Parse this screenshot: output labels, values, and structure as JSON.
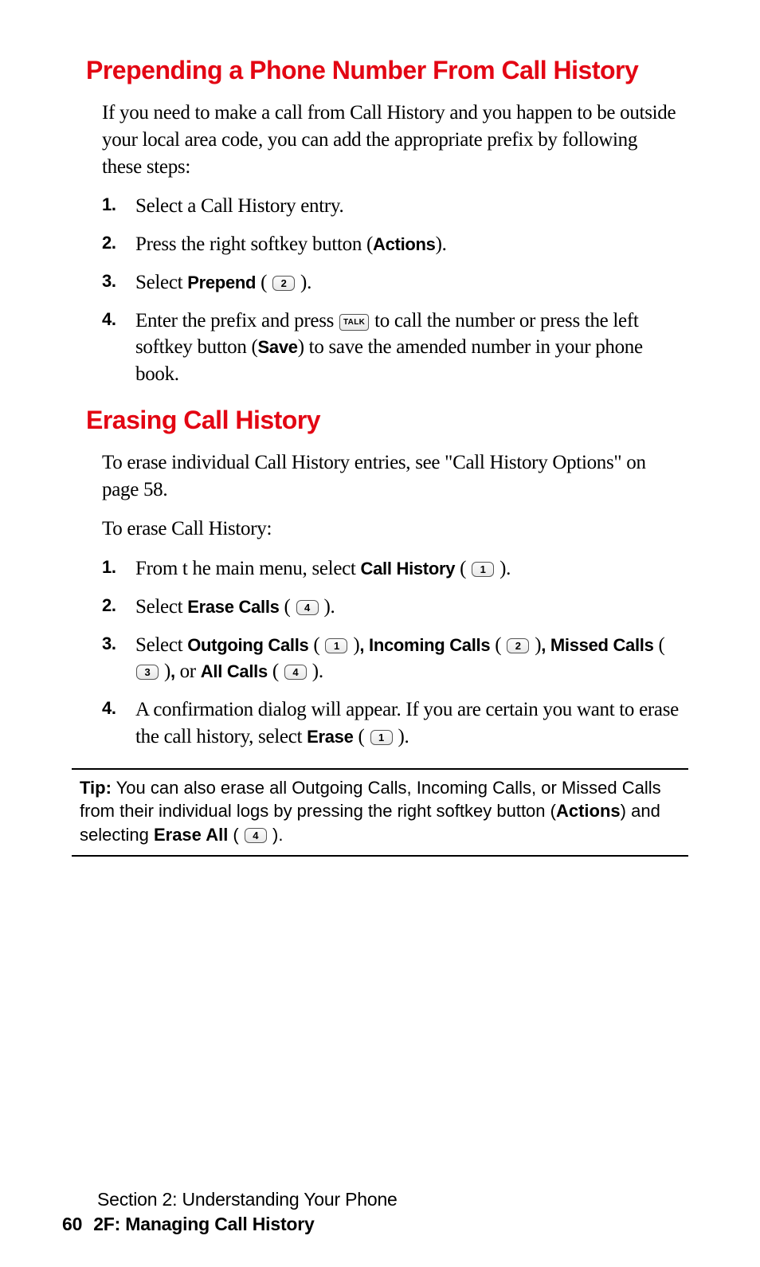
{
  "section1": {
    "heading": "Prepending a Phone Number From Call History",
    "intro": "If you need to make a call from Call History and you happen to be outside your local area code, you can add the appropriate prefix by following these steps:",
    "steps": {
      "n1": "1.",
      "s1": "Select a Call History entry.",
      "n2": "2.",
      "s2a": "Press the right softkey button (",
      "s2b": "Actions",
      "s2c": ").",
      "n3": "3.",
      "s3a": "Select ",
      "s3b": "Prepend",
      "s3c": " ( ",
      "s3key": "2",
      "s3d": " ).",
      "n4": "4.",
      "s4a": "Enter the prefix and press ",
      "s4talk": "TALK",
      "s4b": " to call the number or press the left softkey button (",
      "s4c": "Save",
      "s4d": ") to save the amended number in your phone book."
    }
  },
  "section2": {
    "heading": "Erasing Call History",
    "intro1": "To erase individual Call History entries, see \"Call History Options\" on page 58.",
    "intro2": "To erase Call History:",
    "steps": {
      "n1": "1.",
      "s1a": "From t he main menu, select ",
      "s1b": "Call History",
      "s1c": " ( ",
      "s1key": "1",
      "s1d": " ).",
      "n2": "2.",
      "s2a": "Select ",
      "s2b": "Erase Calls",
      "s2c": " ( ",
      "s2key": "4",
      "s2d": " ).",
      "n3": "3.",
      "s3a": "Select ",
      "s3b": "Outgoing Calls",
      "s3c": " ( ",
      "s3k1": "1",
      "s3d": " )",
      "s3comma1": ", ",
      "s3e": "Incoming Calls",
      "s3f": " ( ",
      "s3k2": "2",
      "s3g": " )",
      "s3comma2": ", ",
      "s3h": "Missed Calls",
      "s3i": " ( ",
      "s3k3": "3",
      "s3j": " )",
      "s3comma3": ", ",
      "s3or": "or ",
      "s3k": "All Calls",
      "s3l": " ( ",
      "s3k4": "4",
      "s3m": " ).",
      "n4": "4.",
      "s4a": "A confirmation dialog will appear. If you are certain you want to erase the call history, select ",
      "s4b": "Erase",
      "s4c": " ( ",
      "s4key": "1",
      "s4d": " )."
    }
  },
  "tip": {
    "label": "Tip:",
    "t1": " You can also erase all Outgoing Calls, Incoming Calls, or Missed Calls from their individual logs by pressing the right softkey button (",
    "t2": "Actions",
    "t3": ") and selecting ",
    "t4": "Erase All",
    "t5": " ( ",
    "tkey": "4",
    "t6": " )."
  },
  "footer": {
    "section_line": "Section 2: Understanding Your Phone",
    "page_num": "60",
    "chapter": "2F: Managing Call History"
  }
}
